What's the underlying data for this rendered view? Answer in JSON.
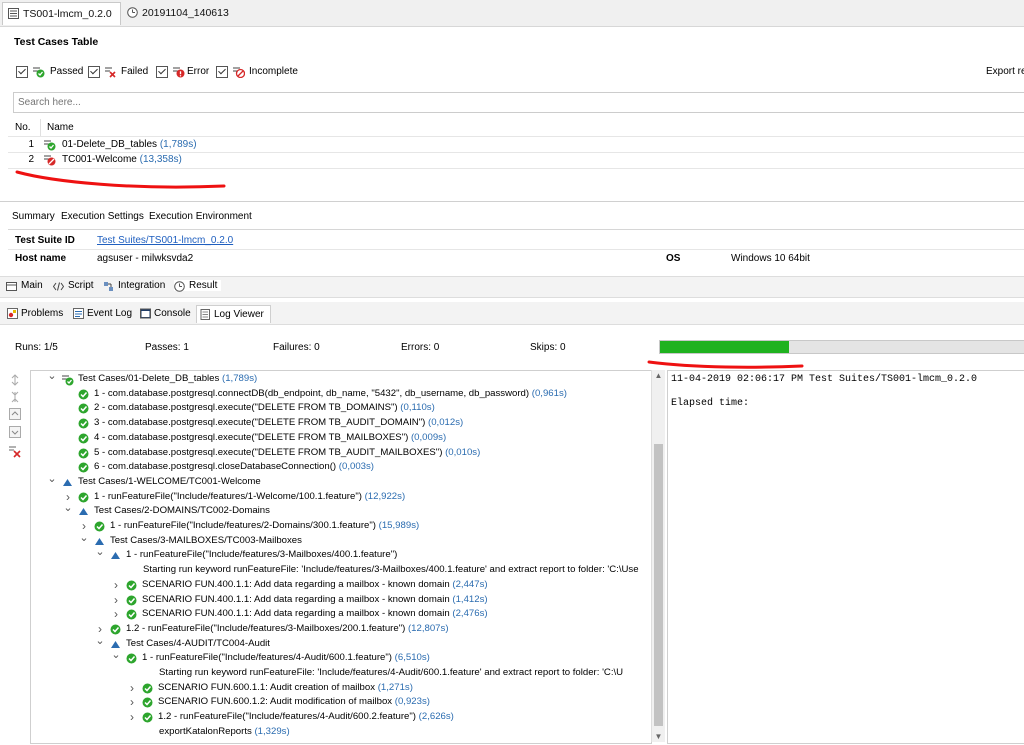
{
  "editor_tabs": [
    {
      "label": "TS001-lmcm_0.2.0",
      "icon": "test-suite-icon",
      "active": true
    },
    {
      "label": "20191104_140613",
      "icon": "report-clock-icon",
      "active": false
    }
  ],
  "test_cases_table": {
    "title": "Test Cases Table",
    "filters": [
      {
        "label": "Passed",
        "checked": true,
        "icon": "passed-icon"
      },
      {
        "label": "Failed",
        "checked": true,
        "icon": "failed-icon"
      },
      {
        "label": "Error",
        "checked": true,
        "icon": "error-icon"
      },
      {
        "label": "Incomplete",
        "checked": true,
        "icon": "incomplete-icon"
      }
    ],
    "export_label": "Export re",
    "search_placeholder": "Search here...",
    "columns": {
      "no": "No.",
      "name": "Name"
    },
    "rows": [
      {
        "no": "1",
        "name": "01-Delete_DB_tables",
        "time": "(1,789s)",
        "status": "passed"
      },
      {
        "no": "2",
        "name": "TC001-Welcome",
        "time": "(13,358s)",
        "status": "failed"
      }
    ]
  },
  "detail_tabs": [
    "Summary",
    "Execution Settings",
    "Execution Environment"
  ],
  "summary": {
    "suite_id_label": "Test Suite ID",
    "suite_id_value": "Test Suites/TS001-lmcm_0.2.0",
    "host_label": "Host name",
    "host_value": "agsuser - milwksvda2",
    "os_label": "OS",
    "os_value": "Windows 10 64bit"
  },
  "editor_bottom_tabs": [
    {
      "label": "Main",
      "icon": "main-icon"
    },
    {
      "label": "Script",
      "icon": "script-icon"
    },
    {
      "label": "Integration",
      "icon": "integration-icon"
    },
    {
      "label": "Result",
      "icon": "result-icon"
    }
  ],
  "view_tabs": [
    {
      "label": "Problems",
      "icon": "problems-icon",
      "active": false
    },
    {
      "label": "Event Log",
      "icon": "event-log-icon",
      "active": false
    },
    {
      "label": "Console",
      "icon": "console-icon",
      "active": false
    },
    {
      "label": "Log Viewer",
      "icon": "log-viewer-icon",
      "active": true
    }
  ],
  "stats": {
    "runs": "Runs:  1/5",
    "passes": "Passes:  1",
    "failures": "Failures:  0",
    "errors": "Errors:  0",
    "skips": "Skips:  0",
    "progress_fraction": 0.35
  },
  "tree": [
    {
      "level": 0,
      "twisty": "open",
      "icon": "tc-passed",
      "text": "Test Cases/01-Delete_DB_tables",
      "time": "(1,789s)"
    },
    {
      "level": 1,
      "twisty": "none",
      "icon": "step-passed",
      "text": "1 - com.database.postgresql.connectDB(db_endpoint, db_name, \"5432\", db_username, db_password)",
      "time": "(0,961s)"
    },
    {
      "level": 1,
      "twisty": "none",
      "icon": "step-passed",
      "text": "2 - com.database.postgresql.execute(\"DELETE FROM TB_DOMAINS\")",
      "time": "(0,110s)"
    },
    {
      "level": 1,
      "twisty": "none",
      "icon": "step-passed",
      "text": "3 - com.database.postgresql.execute(\"DELETE FROM TB_AUDIT_DOMAIN\")",
      "time": "(0,012s)"
    },
    {
      "level": 1,
      "twisty": "none",
      "icon": "step-passed",
      "text": "4 - com.database.postgresql.execute(\"DELETE FROM TB_MAILBOXES\")",
      "time": "(0,009s)"
    },
    {
      "level": 1,
      "twisty": "none",
      "icon": "step-passed",
      "text": "5 - com.database.postgresql.execute(\"DELETE FROM TB_AUDIT_MAILBOXES\")",
      "time": "(0,010s)"
    },
    {
      "level": 1,
      "twisty": "none",
      "icon": "step-passed",
      "text": "6 - com.database.postgresql.closeDatabaseConnection()",
      "time": "(0,003s)"
    },
    {
      "level": 0,
      "twisty": "open",
      "icon": "running",
      "text": "Test Cases/1-WELCOME/TC001-Welcome",
      "time": ""
    },
    {
      "level": 1,
      "twisty": "closed",
      "icon": "step-passed",
      "text": "1 - runFeatureFile(\"Include/features/1-Welcome/100.1.feature\")",
      "time": "(12,922s)"
    },
    {
      "level": 1,
      "twisty": "open",
      "icon": "running",
      "text": "Test Cases/2-DOMAINS/TC002-Domains",
      "time": ""
    },
    {
      "level": 2,
      "twisty": "closed",
      "icon": "step-passed",
      "text": "1 - runFeatureFile(\"Include/features/2-Domains/300.1.feature\")",
      "time": "(15,989s)"
    },
    {
      "level": 2,
      "twisty": "open",
      "icon": "running",
      "text": "Test Cases/3-MAILBOXES/TC003-Mailboxes",
      "time": ""
    },
    {
      "level": 3,
      "twisty": "open",
      "icon": "running",
      "text": "1 - runFeatureFile(\"Include/features/3-Mailboxes/400.1.feature\")",
      "time": ""
    },
    {
      "level": 4,
      "twisty": "none",
      "icon": "none",
      "text": "Starting run keyword runFeatureFile: 'Include/features/3-Mailboxes/400.1.feature' and extract report to folder: 'C:\\Use",
      "time": ""
    },
    {
      "level": 4,
      "twisty": "closed",
      "icon": "step-passed",
      "text": "SCENARIO FUN.400.1.1: Add data regarding a mailbox - known domain",
      "time": "(2,447s)"
    },
    {
      "level": 4,
      "twisty": "closed",
      "icon": "step-passed",
      "text": "SCENARIO FUN.400.1.1: Add data regarding a mailbox - known domain",
      "time": "(1,412s)"
    },
    {
      "level": 4,
      "twisty": "closed",
      "icon": "step-passed",
      "text": "SCENARIO FUN.400.1.1: Add data regarding a mailbox - known domain",
      "time": "(2,476s)"
    },
    {
      "level": 3,
      "twisty": "closed",
      "icon": "step-passed",
      "text": "1.2 - runFeatureFile(\"Include/features/3-Mailboxes/200.1.feature\")",
      "time": "(12,807s)"
    },
    {
      "level": 3,
      "twisty": "open",
      "icon": "running",
      "text": "Test Cases/4-AUDIT/TC004-Audit",
      "time": ""
    },
    {
      "level": 4,
      "twisty": "open",
      "icon": "step-passed",
      "text": "1 - runFeatureFile(\"Include/features/4-Audit/600.1.feature\")",
      "time": "(6,510s)"
    },
    {
      "level": 5,
      "twisty": "none",
      "icon": "none",
      "text": "Starting run keyword runFeatureFile: 'Include/features/4-Audit/600.1.feature' and extract report to folder: 'C:\\U",
      "time": ""
    },
    {
      "level": 5,
      "twisty": "closed",
      "icon": "step-passed",
      "text": "SCENARIO FUN.600.1.1: Audit creation of mailbox",
      "time": "(1,271s)"
    },
    {
      "level": 5,
      "twisty": "closed",
      "icon": "step-passed",
      "text": "SCENARIO FUN.600.1.2: Audit modification of mailbox",
      "time": "(0,923s)"
    },
    {
      "level": 5,
      "twisty": "closed",
      "icon": "step-passed",
      "text": "1.2 - runFeatureFile(\"Include/features/4-Audit/600.2.feature\")",
      "time": "(2,626s)"
    },
    {
      "level": 5,
      "twisty": "none",
      "icon": "none",
      "text": "exportKatalonReports",
      "time": "(1,329s)"
    }
  ],
  "log": {
    "line1": "11-04-2019 02:06:17 PM Test Suites/TS001-lmcm_0.2.0",
    "line2": "Elapsed time:"
  },
  "colors": {
    "passed": "#2da52d",
    "failed": "#d62828",
    "progress": "#1fb21f",
    "link": "#2b6cb0",
    "annotation": "#ee1111"
  }
}
